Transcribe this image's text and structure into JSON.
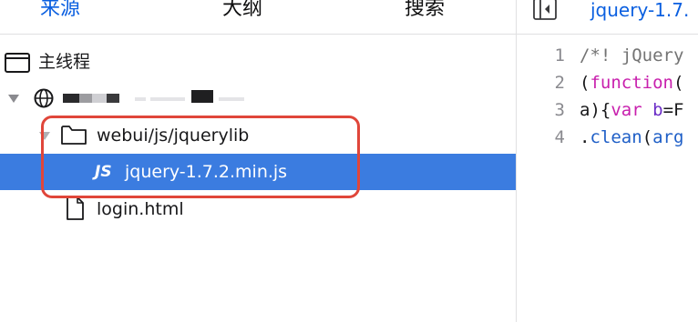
{
  "tabs": [
    {
      "label": "来源",
      "active": true
    },
    {
      "label": "大纲",
      "active": false
    },
    {
      "label": "搜索",
      "active": false
    }
  ],
  "tree": {
    "thread": "主线程",
    "folder": "webui/js/jquerylib",
    "selected_file": {
      "badge": "JS",
      "name": "jquery-1.7.2.min.js"
    },
    "other_file": "login.html"
  },
  "editor": {
    "tab_label": "jquery-1.7.",
    "line_numbers": [
      "1",
      "2",
      "3",
      "4"
    ],
    "lines": [
      [
        {
          "t": "/*! jQuery",
          "c": "comment"
        }
      ],
      [
        {
          "t": "(",
          "c": "text"
        },
        {
          "t": "function",
          "c": "keyword"
        },
        {
          "t": "(",
          "c": "text"
        }
      ],
      [
        {
          "t": "a){",
          "c": "text"
        },
        {
          "t": "var",
          "c": "keyword"
        },
        {
          "t": " ",
          "c": "text"
        },
        {
          "t": "b",
          "c": "var"
        },
        {
          "t": "=F",
          "c": "text"
        }
      ],
      [
        {
          "t": ".",
          "c": "text"
        },
        {
          "t": "clean",
          "c": "prop"
        },
        {
          "t": "(",
          "c": "text"
        },
        {
          "t": "arg",
          "c": "prop"
        }
      ]
    ]
  },
  "colors": {
    "accent": "#0a5fe0",
    "selection": "#3b7ce0",
    "highlight_box": "#e0463a"
  }
}
